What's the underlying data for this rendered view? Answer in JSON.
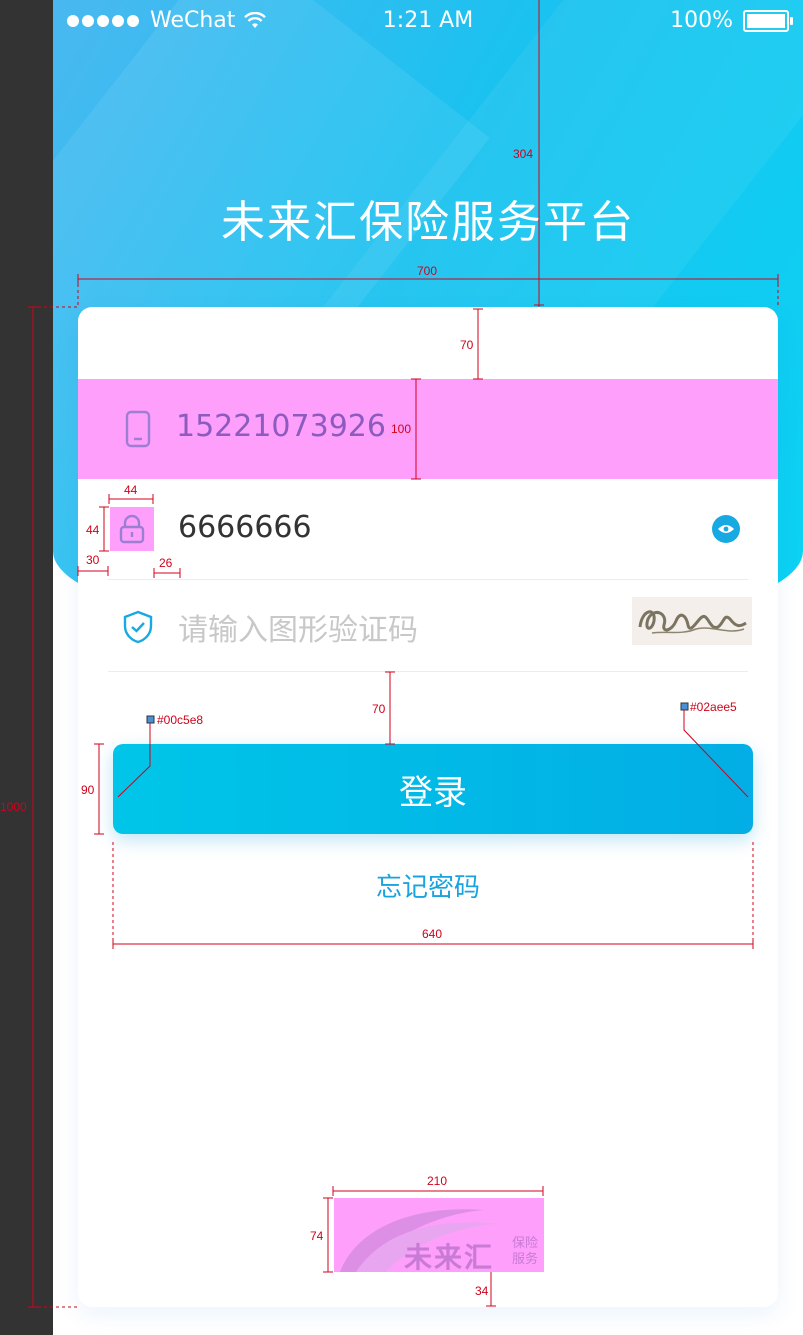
{
  "status_bar": {
    "carrier": "WeChat",
    "time": "1:21 AM",
    "battery": "100%"
  },
  "app_title": "未来汇保险服务平台",
  "form": {
    "phone_value": "15221073926",
    "password_value": "6666666",
    "captcha_placeholder": "请输入图形验证码",
    "login_label": "登录",
    "forgot_label": "忘记密码"
  },
  "logo": {
    "name": "未来汇",
    "sub_line1": "保险",
    "sub_line2": "服务"
  },
  "annotations": {
    "card_width": "700",
    "header_height": "304",
    "card_top_padding": "70",
    "row_height": "100",
    "icon_width": "44",
    "icon_height": "44",
    "icon_left": "30",
    "icon_gap": "26",
    "gap_above_button": "70",
    "button_height": "90",
    "button_width": "640",
    "color_left": "#00c5e8",
    "color_right": "#02aee5",
    "card_height": "1000",
    "logo_width": "210",
    "logo_height": "74",
    "logo_bottom": "34"
  }
}
